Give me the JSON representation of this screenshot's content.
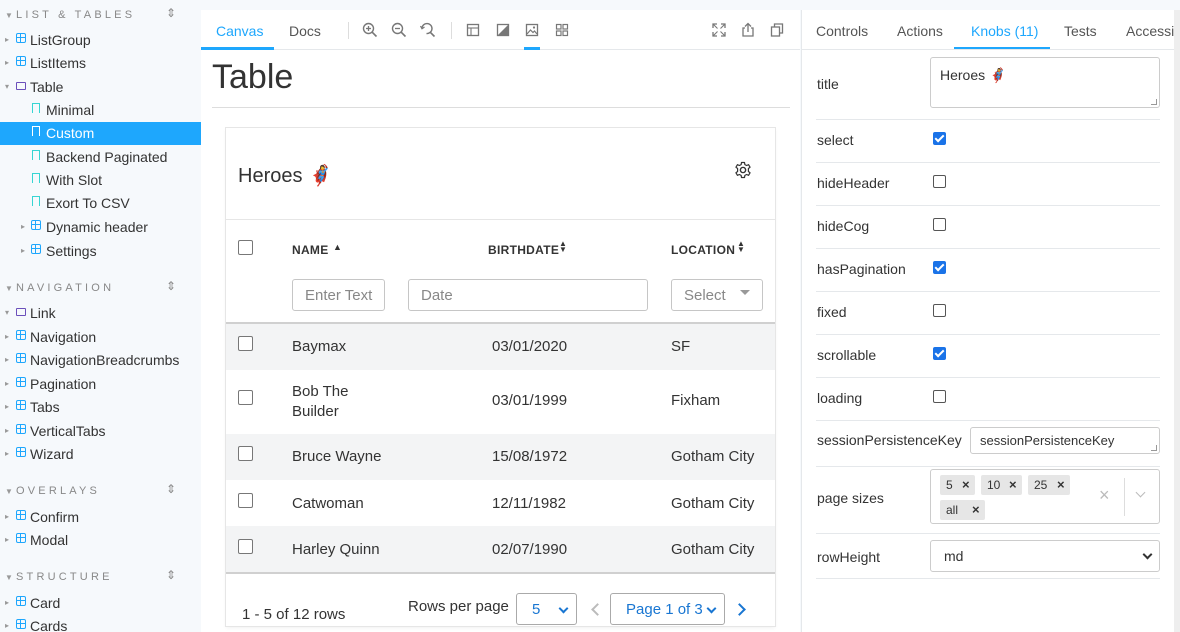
{
  "sidebar": {
    "sections": [
      {
        "title": "LIST & TABLES"
      },
      {
        "title": "NAVIGATION"
      },
      {
        "title": "OVERLAYS"
      },
      {
        "title": "STRUCTURE"
      }
    ],
    "items": [
      {
        "label": "ListGroup"
      },
      {
        "label": "ListItems"
      },
      {
        "label": "Table"
      },
      {
        "label": "Minimal"
      },
      {
        "label": "Custom"
      },
      {
        "label": "Backend Paginated"
      },
      {
        "label": "With Slot"
      },
      {
        "label": "Exort To CSV"
      },
      {
        "label": "Dynamic header"
      },
      {
        "label": "Settings"
      },
      {
        "label": "Link"
      },
      {
        "label": "Navigation"
      },
      {
        "label": "NavigationBreadcrumbs"
      },
      {
        "label": "Pagination"
      },
      {
        "label": "Tabs"
      },
      {
        "label": "VerticalTabs"
      },
      {
        "label": "Wizard"
      },
      {
        "label": "Confirm"
      },
      {
        "label": "Modal"
      },
      {
        "label": "Card"
      },
      {
        "label": "Cards"
      }
    ]
  },
  "toolbar": {
    "tabs": [
      {
        "label": "Canvas"
      },
      {
        "label": "Docs"
      }
    ],
    "icons": [
      "zoom-in-icon",
      "zoom-out-icon",
      "zoom-reset-icon",
      "background-icon",
      "contrast-icon",
      "image-icon",
      "grid-icon",
      "fullscreen-icon",
      "share-icon",
      "copy-icon"
    ]
  },
  "page": {
    "title": "Table"
  },
  "table": {
    "title": "Heroes 🦸‍♀️",
    "columns": [
      {
        "label": "NAME",
        "sort": "asc"
      },
      {
        "label": "BIRTHDATE",
        "sort": "both"
      },
      {
        "label": "LOCATION",
        "sort": "both"
      }
    ],
    "filters": {
      "name_placeholder": "Enter Text",
      "date_placeholder": "Date",
      "location_placeholder": "Select"
    },
    "rows": [
      {
        "name": "Baymax",
        "birthdate": "03/01/2020",
        "location": "SF"
      },
      {
        "name": "Bob The Builder",
        "birthdate": "03/01/1999",
        "location": "Fixham"
      },
      {
        "name": "Bruce Wayne",
        "birthdate": "15/08/1972",
        "location": "Gotham City"
      },
      {
        "name": "Catwoman",
        "birthdate": "12/11/1982",
        "location": "Gotham City"
      },
      {
        "name": "Harley Quinn",
        "birthdate": "02/07/1990",
        "location": "Gotham City"
      }
    ],
    "footer": {
      "range": "1 - 5 of 12 rows",
      "rows_per_page_label": "Rows per page",
      "rows_per_page": "5",
      "page": "Page 1 of 3"
    }
  },
  "addons": {
    "tabs": [
      {
        "label": "Controls"
      },
      {
        "label": "Actions"
      },
      {
        "label": "Knobs (11)"
      },
      {
        "label": "Tests"
      },
      {
        "label": "Accessibility"
      }
    ],
    "knobs": {
      "title": {
        "label": "title",
        "value": "Heroes 🦸‍♀️"
      },
      "select": {
        "label": "select",
        "checked": true
      },
      "hideHeader": {
        "label": "hideHeader",
        "checked": false
      },
      "hideCog": {
        "label": "hideCog",
        "checked": false
      },
      "hasPagination": {
        "label": "hasPagination",
        "checked": true
      },
      "fixed": {
        "label": "fixed",
        "checked": false
      },
      "scrollable": {
        "label": "scrollable",
        "checked": true
      },
      "loading": {
        "label": "loading",
        "checked": false
      },
      "sessionPersistenceKey": {
        "label": "sessionPersistenceKey",
        "value": "sessionPersistenceKey"
      },
      "pageSizes": {
        "label": "page sizes",
        "tags": [
          "5",
          "10",
          "25",
          "all"
        ]
      },
      "rowHeight": {
        "label": "rowHeight",
        "value": "md"
      }
    }
  },
  "colors": {
    "accent": "#1ea7fd",
    "checkbox": "#1a73e8",
    "pagination": "#1976d2"
  }
}
